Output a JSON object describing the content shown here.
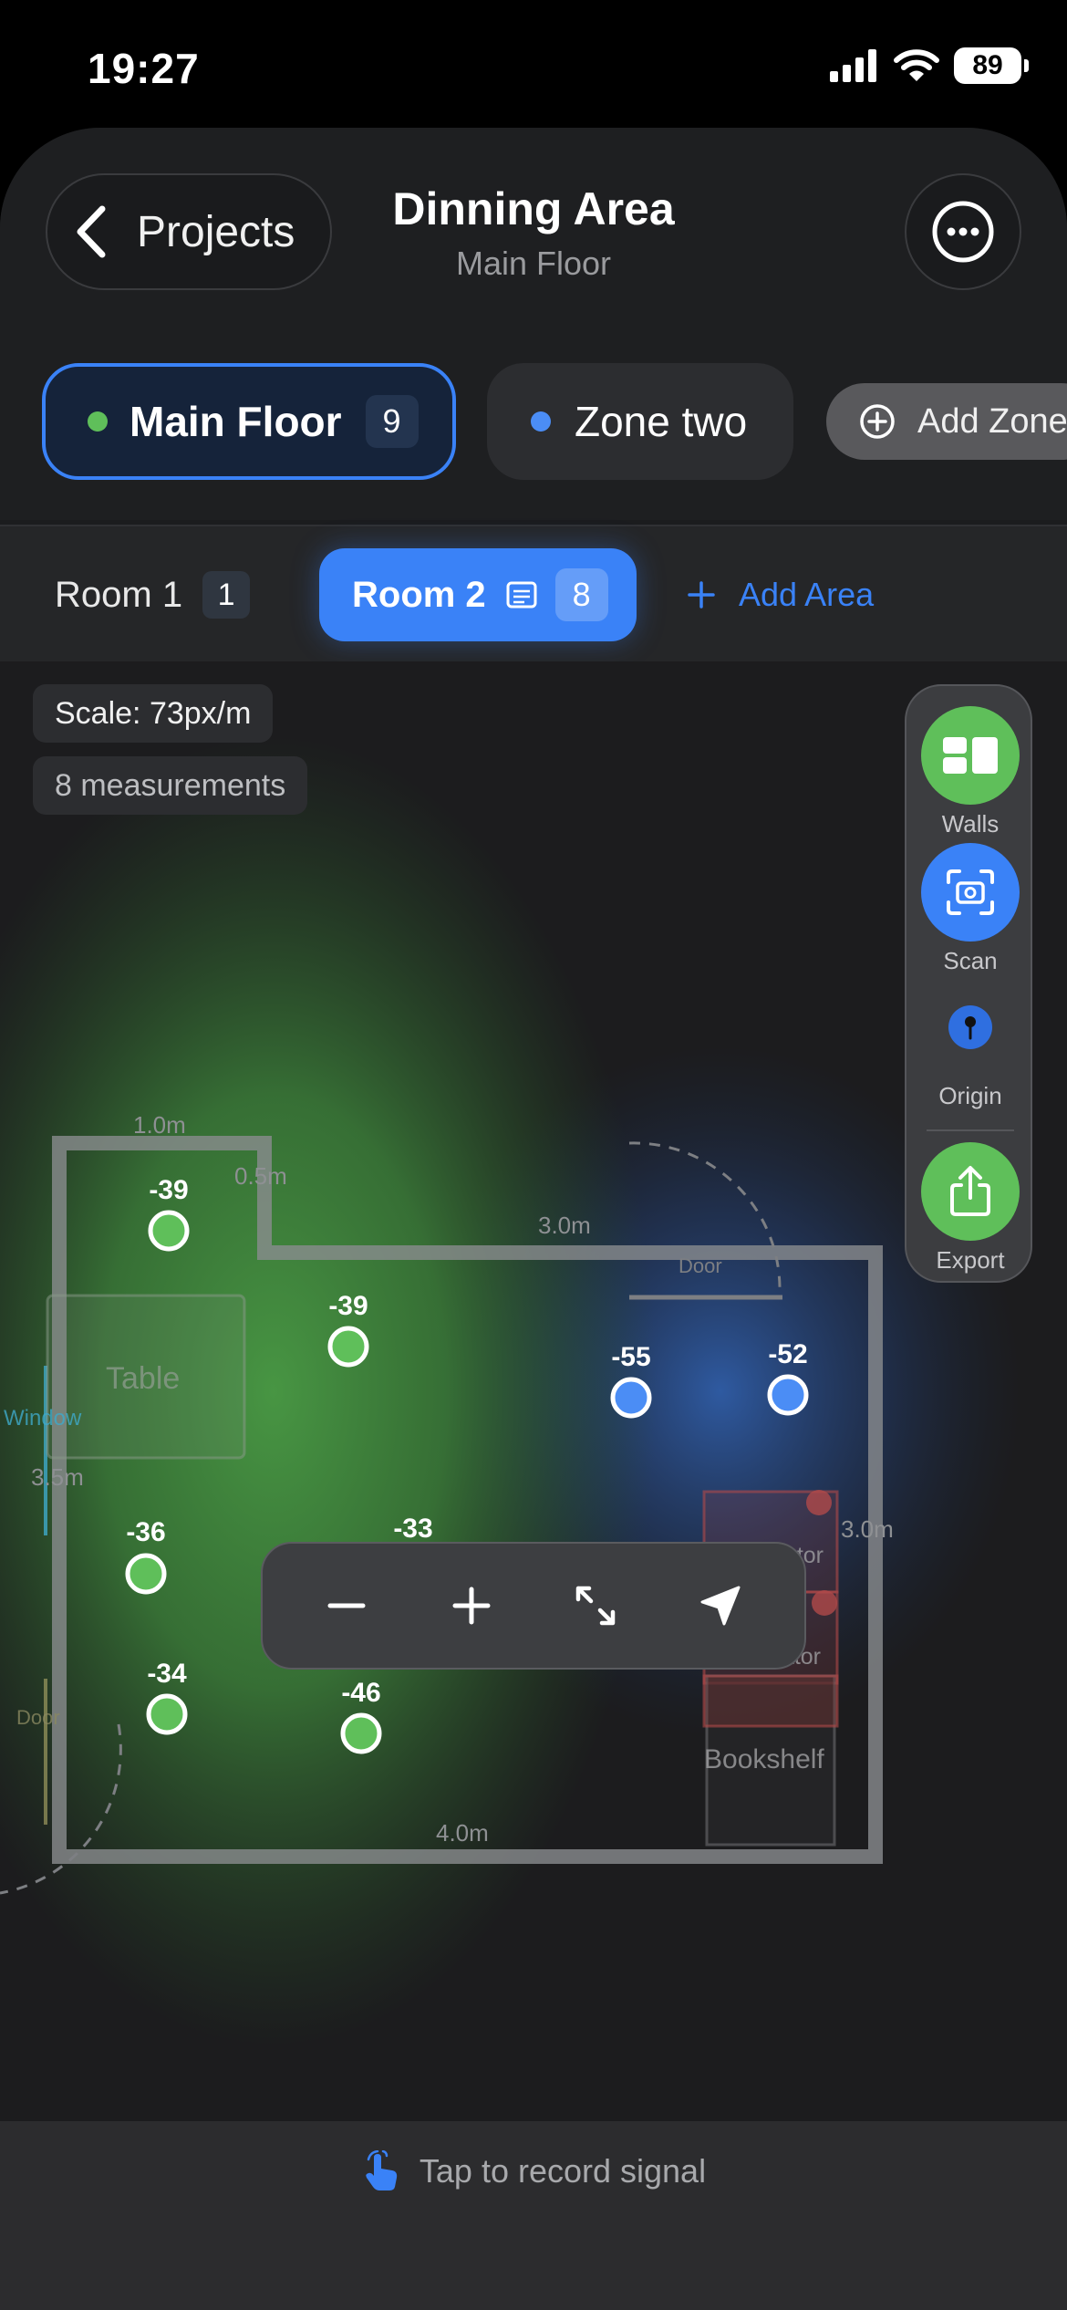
{
  "status_bar": {
    "time": "19:27",
    "battery": "89"
  },
  "header": {
    "back_label": "Projects",
    "title": "Dinning Area",
    "subtitle": "Main Floor"
  },
  "zones": [
    {
      "label": "Main Floor",
      "count": "9",
      "color": "#5fbf5a",
      "selected": true
    },
    {
      "label": "Zone two",
      "color": "#4b8df5",
      "selected": false
    },
    {
      "label": "Add Zone"
    }
  ],
  "rooms": [
    {
      "label": "Room 1",
      "count": "1"
    },
    {
      "label": "Room 2",
      "count": "8",
      "selected": true
    },
    {
      "label": "Add Area"
    }
  ],
  "map": {
    "scale": "Scale: 73px/m",
    "measurements": "8 measurements",
    "dimensions": [
      "1.0m",
      "0.5m",
      "3.0m",
      "3.5m",
      "3.0m",
      "4.0m"
    ],
    "objects": [
      "Table",
      "Window",
      "Door",
      "Door",
      "Refrigerator",
      "Refrigerator",
      "Bookshelf"
    ],
    "readings": [
      {
        "value": "-39",
        "strength": "good"
      },
      {
        "value": "-39",
        "strength": "good"
      },
      {
        "value": "-55",
        "strength": "fair"
      },
      {
        "value": "-52",
        "strength": "fair"
      },
      {
        "value": "-36",
        "strength": "good"
      },
      {
        "value": "-33",
        "strength": "good"
      },
      {
        "value": "-34",
        "strength": "good"
      },
      {
        "value": "-46",
        "strength": "good"
      }
    ]
  },
  "tools": [
    {
      "label": "Walls",
      "icon": "walls-icon",
      "color": "#5fbf5a"
    },
    {
      "label": "Scan",
      "icon": "camera-scan-icon",
      "color": "#3a82f7"
    },
    {
      "label": "Origin",
      "icon": "pin-icon"
    },
    {
      "label": "Export",
      "icon": "share-icon",
      "color": "#5fbf5a"
    }
  ],
  "bottom": {
    "prompt": "Tap to record signal"
  },
  "colors": {
    "accent": "#3a82f7",
    "good": "#5fbf5a",
    "fair": "#4b8df5"
  }
}
